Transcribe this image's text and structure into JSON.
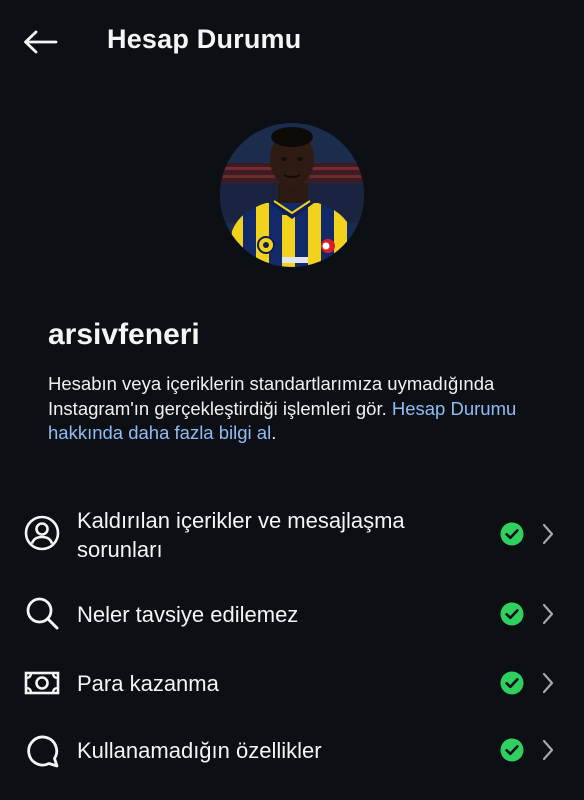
{
  "header": {
    "title": "Hesap Durumu",
    "back_icon": "arrow-left-icon"
  },
  "profile": {
    "username": "arsivfeneri",
    "avatar_icon": "profile-photo"
  },
  "description": {
    "text": "Hesabın veya içeriklerin standartlarımıza uymadığında Instagram'ın gerçekleştirdiği işlemleri gör. ",
    "link_text": "Hesap Durumu hakkında daha fazla bilgi al",
    "trailing": "."
  },
  "menu": {
    "items": [
      {
        "label": "Kaldırılan içerikler ve mesajlaşma sorunları",
        "icon": "user-circle-icon",
        "status_icon": "check-circle-icon"
      },
      {
        "label": "Neler tavsiye edilemez",
        "icon": "search-icon",
        "status_icon": "check-circle-icon"
      },
      {
        "label": "Para kazanma",
        "icon": "banknote-icon",
        "status_icon": "check-circle-icon"
      },
      {
        "label": "Kullanamadığın özellikler",
        "icon": "speech-bubble-icon",
        "status_icon": "check-circle-icon"
      }
    ]
  },
  "colors": {
    "background": "#0c1014",
    "text": "#f5f5f5",
    "link": "#8fbcf5",
    "status_ok": "#2ed160",
    "chevron": "#a8a8a8"
  }
}
